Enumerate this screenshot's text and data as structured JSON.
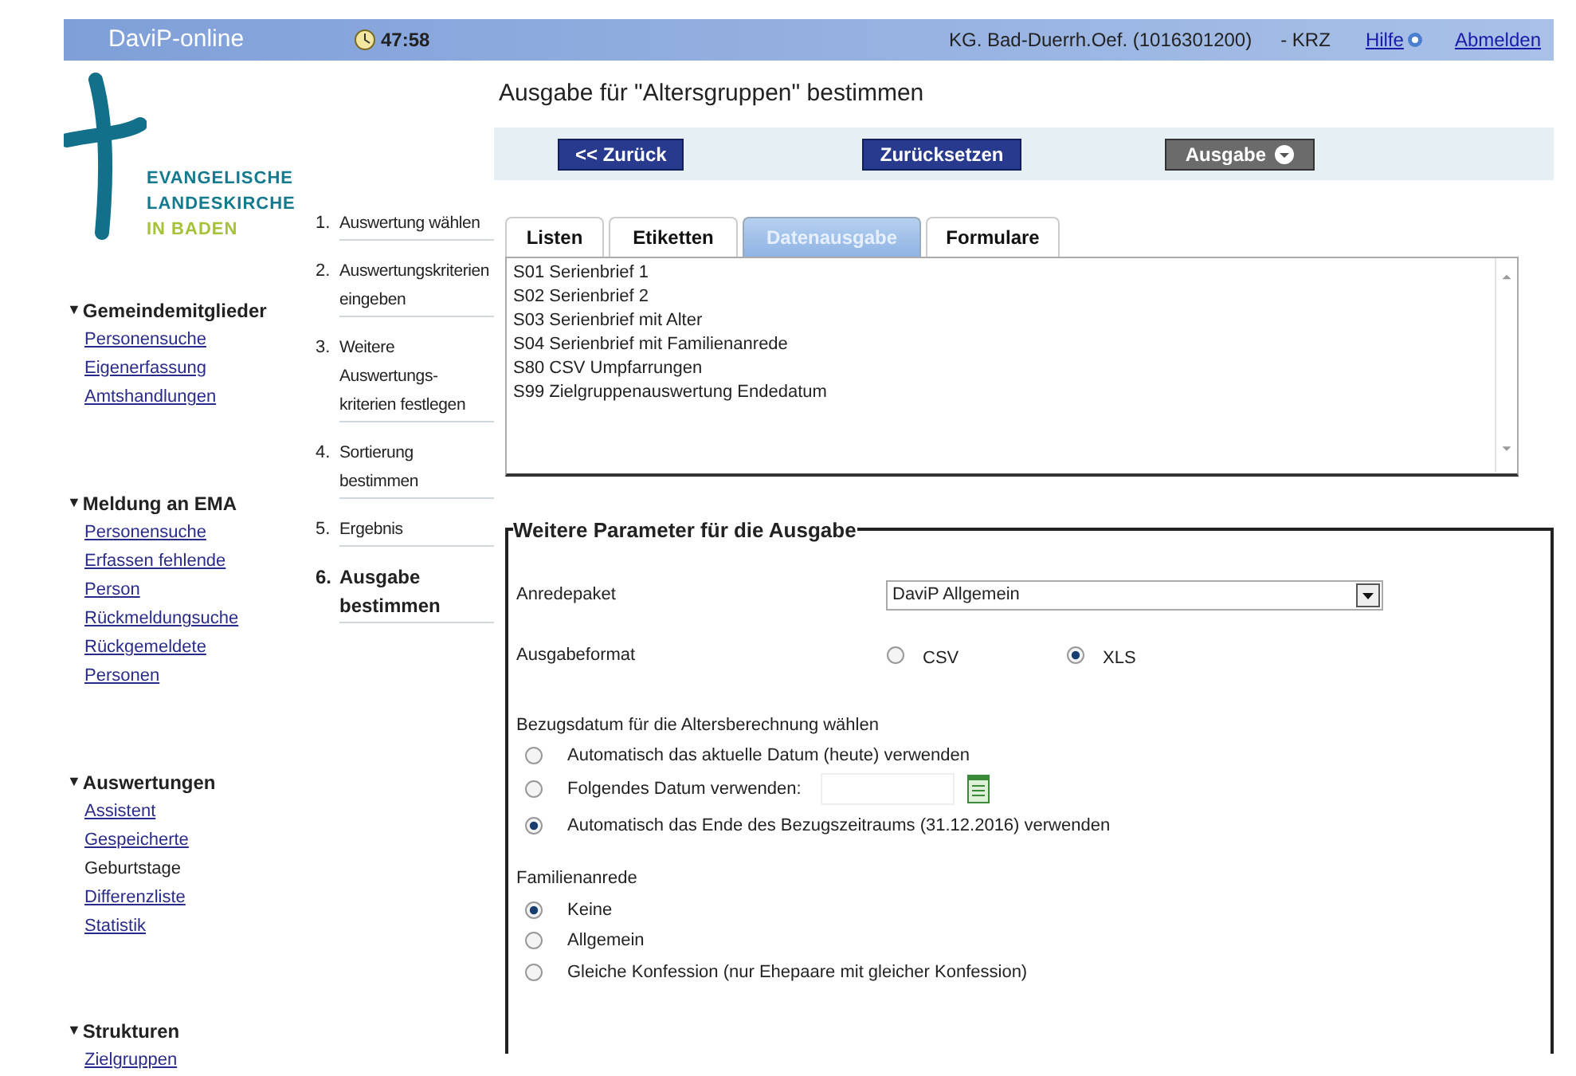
{
  "header": {
    "title": "DaviP-online",
    "timer": "47:58",
    "context": "KG. Bad-Duerrh.Oef. (1016301200)",
    "suffix": "- KRZ",
    "links": [
      "Hilfe",
      "Abmelden"
    ]
  },
  "logo": {
    "lines": [
      "EVANGELISCHE",
      "LANDESKIRCHE",
      "IN BADEN"
    ]
  },
  "nav": {
    "sections": [
      {
        "title": "Gemeindemitglieder",
        "marker": "▼",
        "expanded": true,
        "items": [
          {
            "label": "Personensuche",
            "link": true
          },
          {
            "label": "Eigenerfassung",
            "link": true
          },
          {
            "label": "Amtshandlungen",
            "link": true
          }
        ]
      },
      {
        "title": "Meldung an EMA",
        "marker": "▼",
        "expanded": true,
        "items": [
          {
            "label": "Personensuche",
            "link": true
          },
          {
            "label": "Erfassen fehlende",
            "link": true
          },
          {
            "label": "Person",
            "link": true
          },
          {
            "label": "Rückmeldungsuche",
            "link": true
          },
          {
            "label": "Rückgemeldete",
            "link": true
          },
          {
            "label": "Personen",
            "link": true
          }
        ]
      },
      {
        "title": "Auswertungen",
        "marker": "▼",
        "expanded": true,
        "items": [
          {
            "label": "Assistent",
            "link": true
          },
          {
            "label": "Gespeicherte",
            "link": true
          },
          {
            "label": "Geburtstage",
            "link": false
          },
          {
            "label": "Differenzliste",
            "link": true
          },
          {
            "label": "Statistik",
            "link": true
          }
        ]
      },
      {
        "title": "Strukturen",
        "marker": "▼",
        "expanded": true,
        "items": [
          {
            "label": "Zielgruppen",
            "link": true
          }
        ]
      }
    ]
  },
  "steps": [
    {
      "number": "1.",
      "label": "Auswertung wählen",
      "current": false
    },
    {
      "number": "2.",
      "label": "Auswertungskriterien eingeben",
      "current": false
    },
    {
      "number": "3.",
      "label": "Weitere Auswertungs-kriterien festlegen",
      "current": false
    },
    {
      "number": "4.",
      "label": "Sortierung bestimmen",
      "current": false
    },
    {
      "number": "5.",
      "label": "Ergebnis",
      "current": false
    },
    {
      "number": "6.",
      "label": "Ausgabe bestimmen",
      "current": true
    }
  ],
  "page_title": "Ausgabe für \"Altersgruppen\" bestimmen",
  "toolbar": {
    "buttons": [
      {
        "label": "<< Zurück",
        "kind": "primary"
      },
      {
        "label": "Zurücksetzen",
        "kind": "primary"
      },
      {
        "label": "Ausgabe",
        "kind": "menu"
      }
    ]
  },
  "tabs": [
    {
      "label": "Listen",
      "selected": false
    },
    {
      "label": "Etiketten",
      "selected": false
    },
    {
      "label": "Datenausgabe",
      "selected": true
    },
    {
      "label": "Formulare",
      "selected": false
    }
  ],
  "list": {
    "items": [
      "S01 Serienbrief 1",
      "S02 Serienbrief 2",
      "S03 Serienbrief mit Alter",
      "S04 Serienbrief mit Familienanrede",
      "S80 CSV Umpfarrungen",
      "S99 Zielgruppenauswertung Endedatum"
    ]
  },
  "params": {
    "legend": "Weitere Parameter für die Ausgabe",
    "anredepaket": {
      "label": "Anredepaket",
      "value": "DaviP Allgemein"
    },
    "ausgabeformat": {
      "label": "Ausgabeformat",
      "options": [
        {
          "label": "CSV",
          "selected": false
        },
        {
          "label": "XLS",
          "selected": true
        }
      ]
    },
    "bezugsdatum": {
      "label": "Bezugsdatum für die Altersberechnung wählen",
      "options": [
        {
          "label": "Automatisch das aktuelle Datum (heute) verwenden",
          "selected": false,
          "kind": "plain"
        },
        {
          "label": "Folgendes Datum verwenden:",
          "selected": false,
          "kind": "date"
        },
        {
          "label": "Automatisch das Ende des Bezugszeitraums (31.12.2016) verwenden",
          "selected": true,
          "kind": "plain"
        }
      ]
    },
    "familienanrede": {
      "label": "Familienanrede",
      "options": [
        {
          "label": "Keine",
          "selected": true
        },
        {
          "label": "Allgemein",
          "selected": false
        },
        {
          "label": "Gleiche Konfession (nur Ehepaare mit gleicher Konfession)",
          "selected": false
        }
      ]
    }
  }
}
